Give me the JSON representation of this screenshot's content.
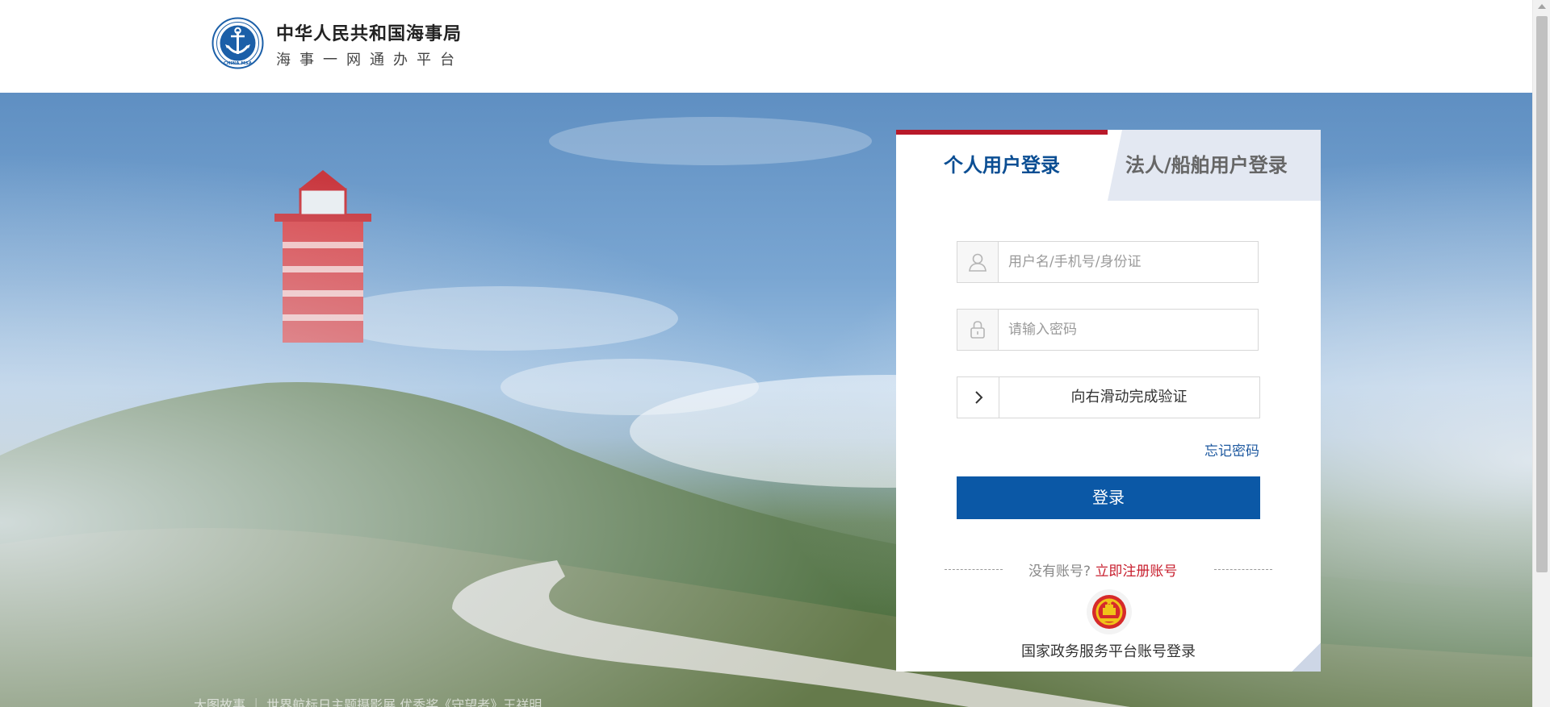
{
  "header": {
    "org_name": "中华人民共和国海事局",
    "platform_name": "海事一网通办平台",
    "logo_icon": "china-msa-logo-icon"
  },
  "hero": {
    "caption": "大图故事 ｜ 世界航标日主题摄影展 优秀奖《守望者》王祥明"
  },
  "login": {
    "tabs": [
      {
        "label": "个人用户登录",
        "active": true
      },
      {
        "label": "法人/船舶用户登录",
        "active": false
      }
    ],
    "username_placeholder": "用户名/手机号/身份证",
    "password_placeholder": "请输入密码",
    "slider_text": "向右滑动完成验证",
    "forgot_label": "忘记密码",
    "submit_label": "登录",
    "no_account_label": "没有账号?",
    "register_label": "立即注册账号",
    "gov_login_label": "国家政务服务平台账号登录"
  },
  "colors": {
    "brand_blue": "#0b58a6",
    "tab_accent_red": "#b8192a",
    "register_red": "#c8202f"
  }
}
